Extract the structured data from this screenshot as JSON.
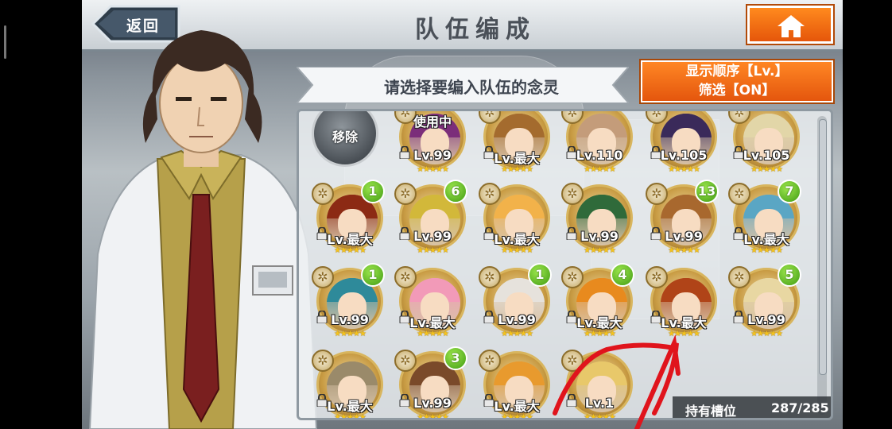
{
  "header": {
    "back_label": "返回",
    "title": "队伍编成"
  },
  "prompt": {
    "text": "请选择要编入队伍的念灵"
  },
  "sort": {
    "line1": "显示顺序【Lv.】",
    "line2": "筛选【ON】"
  },
  "remove": {
    "label": "移除"
  },
  "slots": {
    "label": "持有槽位",
    "value": "287/285"
  },
  "star_glyphs": "★★★★★",
  "colors": {
    "accent_orange": "#e8620f",
    "badge_green": "#4aa318",
    "gold": "#c89b43"
  },
  "cards": [
    {
      "level": "Lv.99",
      "status": "使用中",
      "count": "",
      "stars": 5,
      "hair": "#7b2e7a"
    },
    {
      "level": "Lv.最大",
      "status": "",
      "count": "",
      "stars": 5,
      "hair": "#a46b2e"
    },
    {
      "level": "Lv.110",
      "status": "",
      "count": "",
      "stars": 5,
      "hair": "#c49c7a"
    },
    {
      "level": "Lv.105",
      "status": "",
      "count": "",
      "stars": 5,
      "hair": "#3a2a5a"
    },
    {
      "level": "Lv.105",
      "status": "",
      "count": "",
      "stars": 5,
      "hair": "#e2d6a8"
    },
    {
      "level": "Lv.最大",
      "status": "",
      "count": "1",
      "stars": 5,
      "hair": "#8c2a14"
    },
    {
      "level": "Lv.99",
      "status": "",
      "count": "6",
      "stars": 5,
      "hair": "#d2b83a"
    },
    {
      "level": "Lv.最大",
      "status": "",
      "count": "",
      "stars": 5,
      "hair": "#f2b24a"
    },
    {
      "level": "Lv.99",
      "status": "",
      "count": "",
      "stars": 5,
      "hair": "#2f6a3a"
    },
    {
      "level": "Lv.99",
      "status": "",
      "count": "13",
      "stars": 5,
      "hair": "#a8682e"
    },
    {
      "level": "Lv.最大",
      "status": "",
      "count": "7",
      "stars": 5,
      "hair": "#5aa6c4"
    },
    {
      "level": "Lv.99",
      "status": "",
      "count": "1",
      "stars": 5,
      "hair": "#2e8a9a"
    },
    {
      "level": "Lv.最大",
      "status": "",
      "count": "",
      "stars": 5,
      "hair": "#f29ab8"
    },
    {
      "level": "Lv.99",
      "status": "",
      "count": "1",
      "stars": 5,
      "hair": "#e6e2dc"
    },
    {
      "level": "Lv.最大",
      "status": "",
      "count": "4",
      "stars": 5,
      "hair": "#e88a1e"
    },
    {
      "level": "Lv.最大",
      "status": "",
      "count": "",
      "stars": 5,
      "hair": "#b04418"
    },
    {
      "level": "Lv.99",
      "status": "",
      "count": "5",
      "stars": 5,
      "hair": "#e8d7a2"
    },
    {
      "level": "Lv.最大",
      "status": "",
      "count": "",
      "stars": 5,
      "hair": "#9a8a6a"
    },
    {
      "level": "Lv.99",
      "status": "",
      "count": "3",
      "stars": 5,
      "hair": "#7a4a2a"
    },
    {
      "level": "Lv.最大",
      "status": "",
      "count": "",
      "stars": 5,
      "hair": "#e89a2e"
    },
    {
      "level": "Lv.1",
      "status": "",
      "count": "",
      "stars": 5,
      "hair": "#e8c86a"
    }
  ]
}
